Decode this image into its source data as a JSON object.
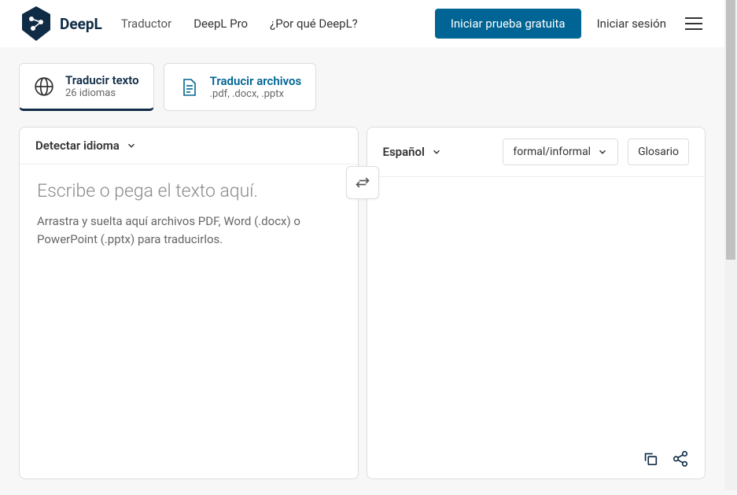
{
  "header": {
    "brand": "DeepL",
    "nav": {
      "translator": "Traductor",
      "pro": "DeepL Pro",
      "why": "¿Por qué DeepL?"
    },
    "cta": "Iniciar prueba gratuita",
    "login": "Iniciar sesión"
  },
  "tabs": {
    "text": {
      "title": "Traducir texto",
      "sub": "26 idiomas"
    },
    "files": {
      "title": "Traducir archivos",
      "sub": ".pdf, .docx, .pptx"
    }
  },
  "source": {
    "lang_label": "Detectar idioma",
    "placeholder": "Escribe o pega el texto aquí.",
    "hint": "Arrastra y suelta aquí archivos PDF, Word (.docx) o PowerPoint (.pptx) para traducirlos."
  },
  "target": {
    "lang_label": "Español",
    "formality": "formal/informal",
    "glossary": "Glosario"
  }
}
